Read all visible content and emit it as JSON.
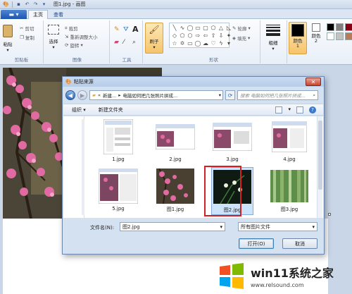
{
  "window": {
    "title": "图1.jpg - 画图"
  },
  "tabs": [
    {
      "label": "主页",
      "active": true
    },
    {
      "label": "查看",
      "active": false
    }
  ],
  "ribbon": {
    "clipboard": {
      "label": "剪贴板",
      "paste": "粘贴",
      "cut": "剪切",
      "copy": "复制"
    },
    "image": {
      "label": "图像",
      "select": "选择",
      "crop": "裁剪",
      "resize": "重新调整大小",
      "rotate": "旋转"
    },
    "tools": {
      "label": "工具"
    },
    "brushes": {
      "label": "刷子"
    },
    "shapes": {
      "label": "形状",
      "outline": "轮廓",
      "fill": "填充"
    },
    "size": {
      "label": "粗细"
    },
    "color1": {
      "label": "颜色 1",
      "color": "#000000"
    },
    "color2": {
      "label": "颜色 2",
      "color": "#ffffff"
    },
    "palette": [
      "#000000",
      "#7f7f7f",
      "#880015",
      "#ffffff",
      "#c3c3c3",
      "#b97a57"
    ]
  },
  "dialog": {
    "title": "粘贴来源",
    "address": {
      "prefix": "«",
      "crumb1": "新建...",
      "crumb2": "电脑如何把几张照片拼成..."
    },
    "search_placeholder": "搜索 电脑如何把几张照片拼成...",
    "toolbar": {
      "organize": "组织 ▾",
      "new_folder": "新建文件夹"
    },
    "files": [
      {
        "name": "1.jpg",
        "selected": false,
        "kind": "window"
      },
      {
        "name": "2.jpg",
        "selected": false,
        "kind": "window"
      },
      {
        "name": "3.jpg",
        "selected": false,
        "kind": "window"
      },
      {
        "name": "4.jpg",
        "selected": false,
        "kind": "window"
      },
      {
        "name": "5.jpg",
        "selected": false,
        "kind": "window"
      },
      {
        "name": "图1.jpg",
        "selected": false,
        "kind": "blossom"
      },
      {
        "name": "图2.jpg",
        "selected": true,
        "kind": "orchid"
      },
      {
        "name": "图3.jpg",
        "selected": false,
        "kind": "bamboo"
      }
    ],
    "filename_label": "文件名(N):",
    "filename_value": "图2.jpg",
    "filetype": "所有图片文件",
    "open_button": "打开(O)",
    "cancel_button": "取消"
  },
  "watermark": {
    "title": "win11系统之家",
    "url": "www.relsound.com"
  }
}
